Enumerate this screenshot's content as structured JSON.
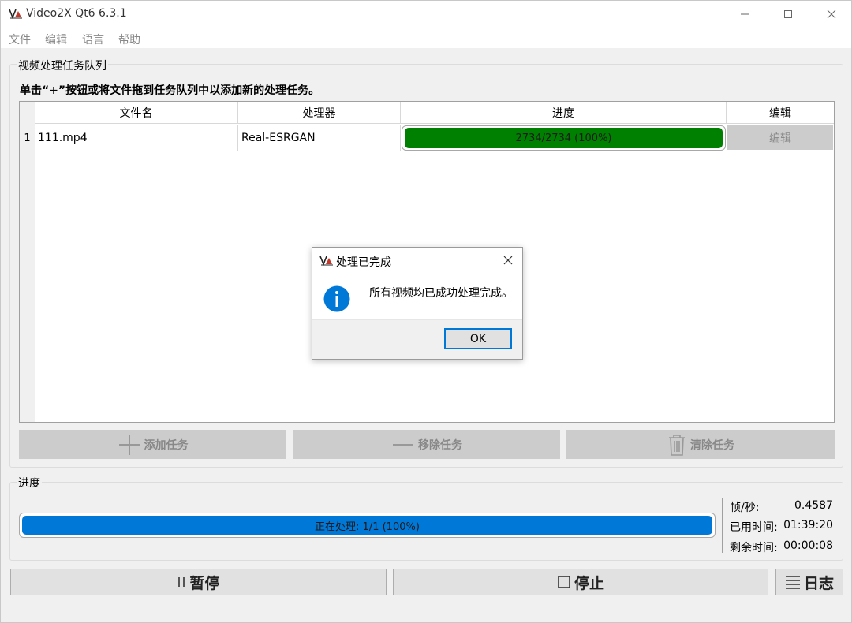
{
  "window": {
    "title": "Video2X Qt6 6.3.1"
  },
  "menu": {
    "items": [
      "文件",
      "编辑",
      "语言",
      "帮助"
    ]
  },
  "queue": {
    "title": "视频处理任务队列",
    "hint": "单击“+”按钮或将文件拖到任务队列中以添加新的处理任务。",
    "columns": [
      "文件名",
      "处理器",
      "进度",
      "编辑"
    ],
    "rows": [
      {
        "index": "1",
        "file": "111.mp4",
        "processor": "Real-ESRGAN",
        "progress_text": "2734/2734 (100%)",
        "progress": 1.0,
        "edit": "编辑"
      }
    ],
    "add_label": "添加任务",
    "remove_label": "移除任务",
    "clear_label": "清除任务"
  },
  "progress": {
    "title": "进度",
    "bar_text": "正在处理: 1/1 (100%)",
    "value": 1.0,
    "fps_label": "帧/秒:",
    "fps_value": "0.4587",
    "elapsed_label": "已用时间:",
    "elapsed_value": "01:39:20",
    "remaining_label": "剩余时间:",
    "remaining_value": "00:00:08"
  },
  "controls": {
    "pause_label": "暂停",
    "stop_label": "停止",
    "log_label": "日志"
  },
  "dialog": {
    "title": "处理已完成",
    "message": "所有视频均已成功处理完成。",
    "ok_label": "OK"
  },
  "colors": {
    "row_progress": "#008000",
    "total_progress": "#0078d7",
    "info_icon": "#0078d7"
  },
  "icons": {
    "app": "video2x-logo-icon",
    "info": "info-icon",
    "add": "plus-icon",
    "remove": "minus-icon",
    "clear": "trash-icon",
    "pause": "pause-icon",
    "stop": "stop-icon",
    "log": "log-lines-icon"
  }
}
